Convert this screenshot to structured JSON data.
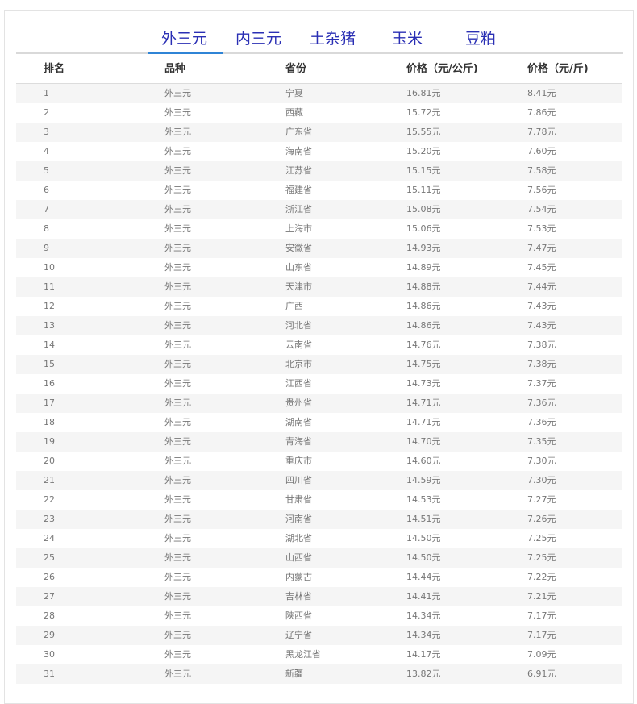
{
  "tabs": [
    {
      "label": "外三元",
      "active": true
    },
    {
      "label": "内三元",
      "active": false
    },
    {
      "label": "土杂猪",
      "active": false
    },
    {
      "label": "玉米",
      "active": false
    },
    {
      "label": "豆粕",
      "active": false
    }
  ],
  "columns": [
    "排名",
    "品种",
    "省份",
    "价格（元/公斤)",
    "价格（元/斤)"
  ],
  "rows": [
    [
      "1",
      "外三元",
      "宁夏",
      "16.81元",
      "8.41元"
    ],
    [
      "2",
      "外三元",
      "西藏",
      "15.72元",
      "7.86元"
    ],
    [
      "3",
      "外三元",
      "广东省",
      "15.55元",
      "7.78元"
    ],
    [
      "4",
      "外三元",
      "海南省",
      "15.20元",
      "7.60元"
    ],
    [
      "5",
      "外三元",
      "江苏省",
      "15.15元",
      "7.58元"
    ],
    [
      "6",
      "外三元",
      "福建省",
      "15.11元",
      "7.56元"
    ],
    [
      "7",
      "外三元",
      "浙江省",
      "15.08元",
      "7.54元"
    ],
    [
      "8",
      "外三元",
      "上海市",
      "15.06元",
      "7.53元"
    ],
    [
      "9",
      "外三元",
      "安徽省",
      "14.93元",
      "7.47元"
    ],
    [
      "10",
      "外三元",
      "山东省",
      "14.89元",
      "7.45元"
    ],
    [
      "11",
      "外三元",
      "天津市",
      "14.88元",
      "7.44元"
    ],
    [
      "12",
      "外三元",
      "广西",
      "14.86元",
      "7.43元"
    ],
    [
      "13",
      "外三元",
      "河北省",
      "14.86元",
      "7.43元"
    ],
    [
      "14",
      "外三元",
      "云南省",
      "14.76元",
      "7.38元"
    ],
    [
      "15",
      "外三元",
      "北京市",
      "14.75元",
      "7.38元"
    ],
    [
      "16",
      "外三元",
      "江西省",
      "14.73元",
      "7.37元"
    ],
    [
      "17",
      "外三元",
      "贵州省",
      "14.71元",
      "7.36元"
    ],
    [
      "18",
      "外三元",
      "湖南省",
      "14.71元",
      "7.36元"
    ],
    [
      "19",
      "外三元",
      "青海省",
      "14.70元",
      "7.35元"
    ],
    [
      "20",
      "外三元",
      "重庆市",
      "14.60元",
      "7.30元"
    ],
    [
      "21",
      "外三元",
      "四川省",
      "14.59元",
      "7.30元"
    ],
    [
      "22",
      "外三元",
      "甘肃省",
      "14.53元",
      "7.27元"
    ],
    [
      "23",
      "外三元",
      "河南省",
      "14.51元",
      "7.26元"
    ],
    [
      "24",
      "外三元",
      "湖北省",
      "14.50元",
      "7.25元"
    ],
    [
      "25",
      "外三元",
      "山西省",
      "14.50元",
      "7.25元"
    ],
    [
      "26",
      "外三元",
      "内蒙古",
      "14.44元",
      "7.22元"
    ],
    [
      "27",
      "外三元",
      "吉林省",
      "14.41元",
      "7.21元"
    ],
    [
      "28",
      "外三元",
      "陕西省",
      "14.34元",
      "7.17元"
    ],
    [
      "29",
      "外三元",
      "辽宁省",
      "14.34元",
      "7.17元"
    ],
    [
      "30",
      "外三元",
      "黑龙江省",
      "14.17元",
      "7.09元"
    ],
    [
      "31",
      "外三元",
      "新疆",
      "13.82元",
      "6.91元"
    ]
  ]
}
